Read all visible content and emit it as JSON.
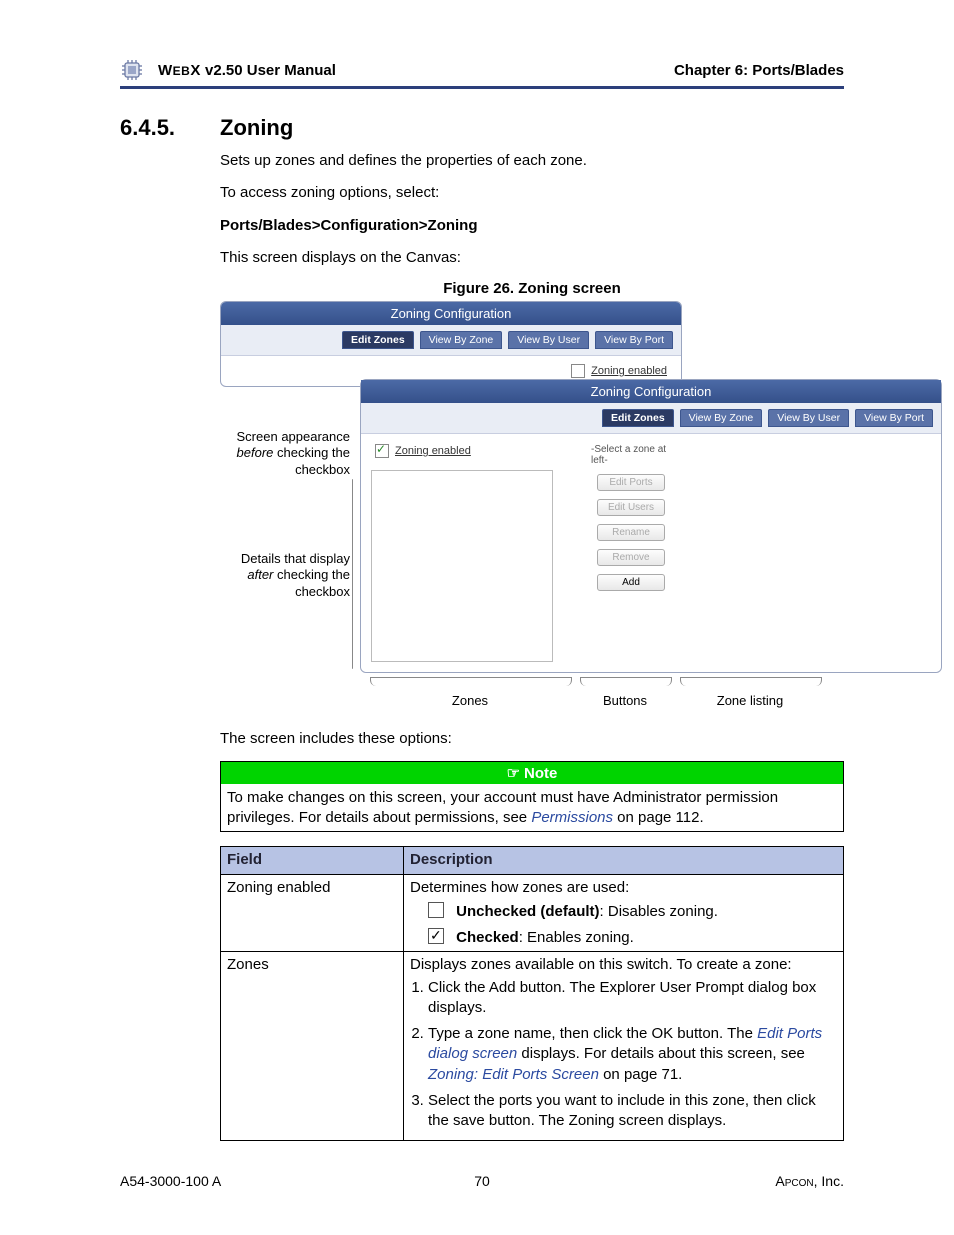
{
  "header": {
    "product": "WebX v2.50 User Manual",
    "chapter": "Chapter 6: Ports/Blades"
  },
  "section": {
    "num": "6.4.5.",
    "title": "Zoning"
  },
  "body": {
    "p1": "Sets up zones and defines the properties of each zone.",
    "p2": "To access zoning options, select:",
    "breadcrumb": "Ports/Blades>Configuration>Zoning",
    "p3": "This screen displays on the Canvas:",
    "figcap": "Figure 26. Zoning screen",
    "p4": "The screen includes these options:"
  },
  "figure": {
    "panel_title": "Zoning Configuration",
    "tabs": [
      "Edit Zones",
      "View By Zone",
      "View By User",
      "View By Port"
    ],
    "cb_label": "Zoning enabled",
    "hint": "-Select a zone at left-",
    "buttons": {
      "edit_ports": "Edit Ports",
      "edit_users": "Edit Users",
      "rename": "Rename",
      "remove": "Remove",
      "add": "Add"
    },
    "annot_before_l1": "Screen appearance",
    "annot_before_l2_i": "before",
    "annot_before_l2_r": " checking the",
    "annot_before_l3": "checkbox",
    "annot_after_l1": "Details that display",
    "annot_after_l2_i": "after",
    "annot_after_l2_r": " checking the",
    "annot_after_l3": "checkbox",
    "under": {
      "zones": "Zones",
      "buttons": "Buttons",
      "listing": "Zone listing"
    }
  },
  "note": {
    "title": "Note",
    "text_a": "To make changes on this screen, your account must have Administrator permission privileges. For details about permissions, see ",
    "link": "Permissions",
    "text_b": " on page 112."
  },
  "table": {
    "h1": "Field",
    "h2": "Description",
    "r1": {
      "field": "Zoning enabled",
      "intro": "Determines how zones are used:",
      "unchecked_b": "Unchecked (default)",
      "unchecked_r": ": Disables zoning.",
      "checked_b": "Checked",
      "checked_r": ": Enables zoning."
    },
    "r2": {
      "field": "Zones",
      "intro": "Displays zones available on this switch. To create a zone:",
      "s1": "Click the Add button. The Explorer User Prompt dialog box displays.",
      "s2a": "Type a zone name, then click the OK button. The ",
      "s2link1": "Edit Ports dialog screen",
      "s2b": "  displays. For details about this screen, see ",
      "s2link2": "Zoning: Edit Ports Screen",
      "s2c": " on page 71.",
      "s3": "Select the ports you want to include in this zone, then click the save button. The Zoning screen displays."
    }
  },
  "footer": {
    "left": "A54-3000-100 A",
    "page": "70",
    "right_a": "Apcon",
    "right_b": ", Inc."
  }
}
